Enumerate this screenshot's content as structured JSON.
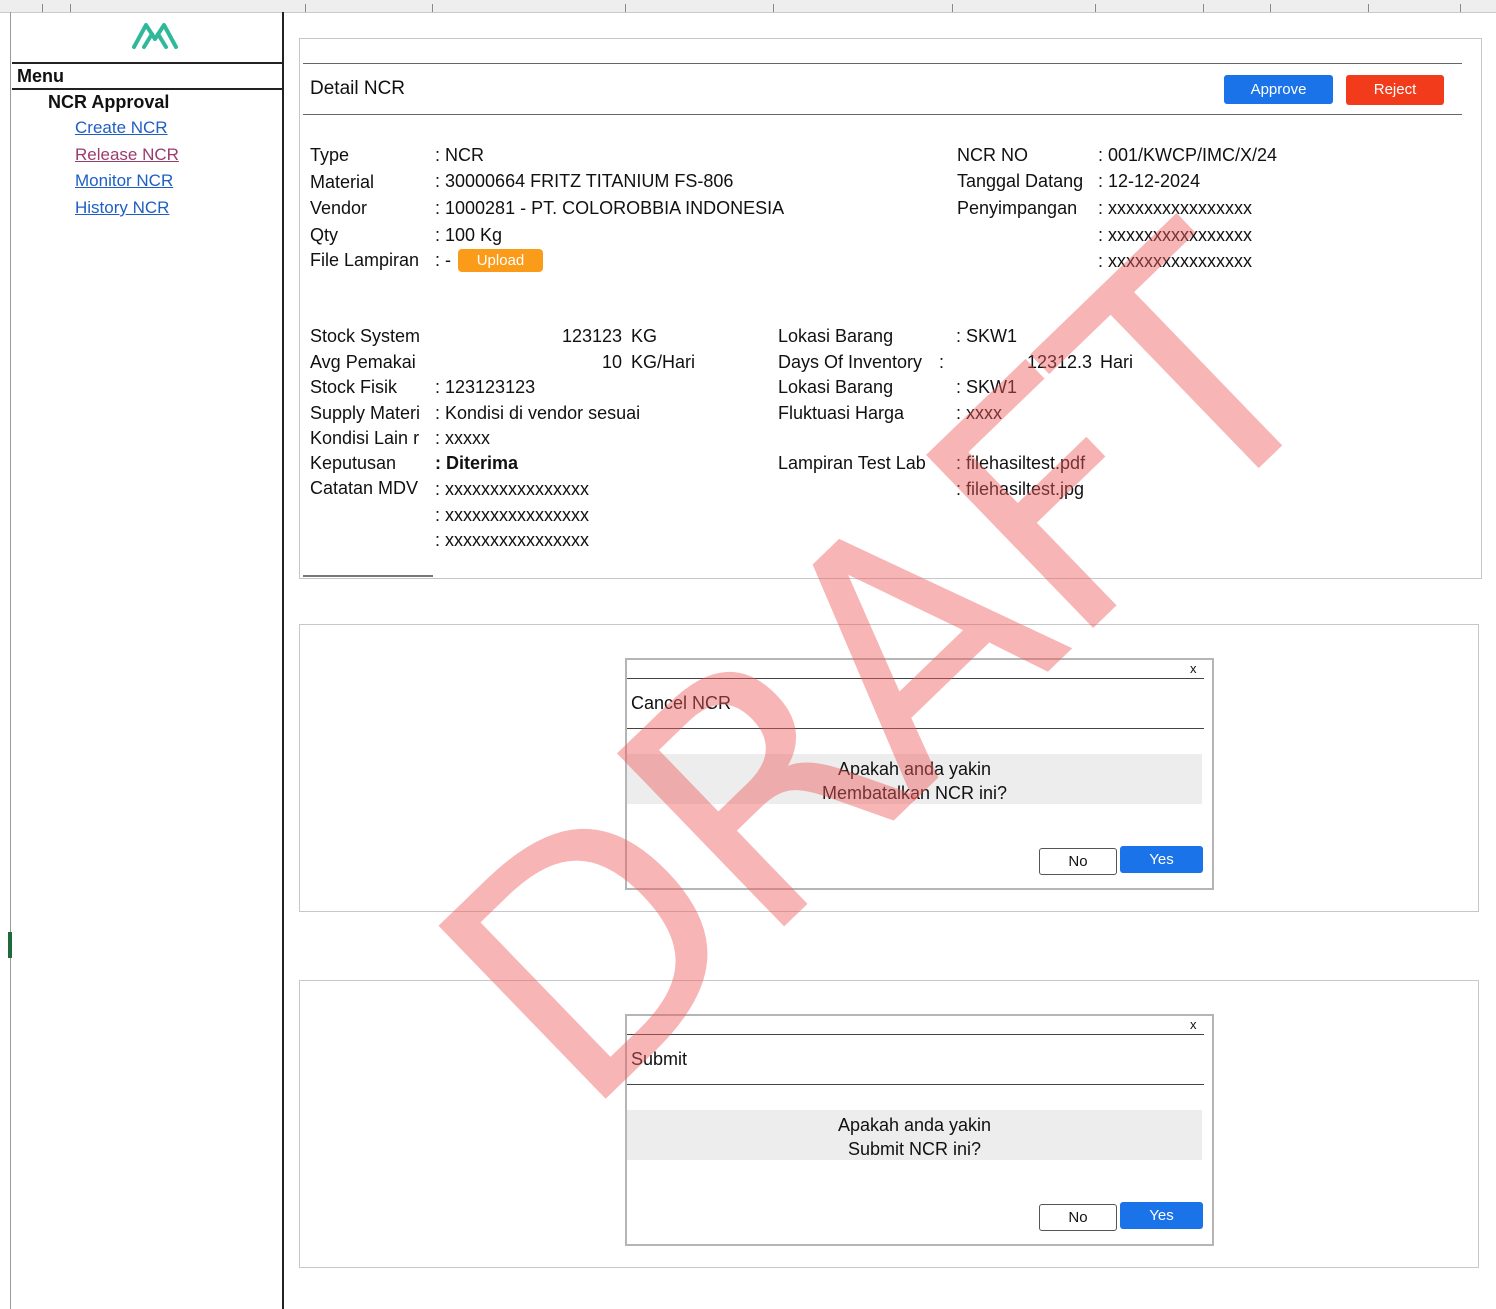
{
  "sidebar": {
    "menu_label": "Menu",
    "section_title": "NCR Approval",
    "items": [
      {
        "label": "Create NCR",
        "color": "#1f5fc4"
      },
      {
        "label": "Release NCR",
        "color": "#9b3c6e"
      },
      {
        "label": "Monitor NCR",
        "color": "#1f5fc4"
      },
      {
        "label": "History NCR",
        "color": "#1f5fc4"
      }
    ]
  },
  "detail": {
    "title": "Detail NCR",
    "approve_label": "Approve",
    "reject_label": "Reject",
    "upload_label": "Upload",
    "left": [
      {
        "label": "Type",
        "value": ": NCR"
      },
      {
        "label": "Material",
        "value": ": 30000664 FRITZ TITANIUM FS-806"
      },
      {
        "label": "Vendor",
        "value": ": 1000281 - PT. COLOROBBIA INDONESIA"
      },
      {
        "label": "Qty",
        "value": ": 100 Kg"
      },
      {
        "label": "File Lampiran",
        "value": ": -"
      }
    ],
    "right": [
      {
        "label": "NCR NO",
        "value": ": 001/KWCP/IMC/X/24"
      },
      {
        "label": "Tanggal Datang",
        "value": ": 12-12-2024"
      },
      {
        "label": "Penyimpangan",
        "value": ": xxxxxxxxxxxxxxxx"
      },
      {
        "label": "",
        "value": ": xxxxxxxxxxxxxxxx"
      },
      {
        "label": "",
        "value": ": xxxxxxxxxxxxxxxx"
      }
    ],
    "stock_system": {
      "label": "Stock System",
      "value": "123123",
      "unit": "KG"
    },
    "avg_pemakaian": {
      "label": "Avg Pemakai",
      "value": "10",
      "unit": "KG/Hari"
    },
    "stock_fisik": {
      "label": "Stock Fisik",
      "value": ": 123123123"
    },
    "supply": {
      "label": "Supply Materi",
      "value": ": Kondisi di vendor sesuai"
    },
    "kondisi": {
      "label": "Kondisi Lain r",
      "value": ": xxxxx"
    },
    "keputusan": {
      "label": "Keputusan",
      "value": ": Diterima"
    },
    "catatan": {
      "label": "Catatan MDV",
      "values": [
        ": xxxxxxxxxxxxxxxx",
        ": xxxxxxxxxxxxxxxx",
        ": xxxxxxxxxxxxxxxx"
      ]
    },
    "lokasi1": {
      "label": "Lokasi Barang",
      "value": ": SKW1"
    },
    "days_inventory": {
      "label": "Days Of Inventory",
      "colon": ":",
      "value": "12312.3",
      "unit": "Hari"
    },
    "lokasi2": {
      "label": "Lokasi Barang",
      "value": ": SKW1"
    },
    "fluktuasi": {
      "label": "Fluktuasi Harga",
      "value": ": xxxx"
    },
    "lampiran_lab": {
      "label": "Lampiran Test Lab",
      "values": [
        ": filehasiltest.pdf",
        ": filehasiltest.jpg"
      ]
    }
  },
  "cancel_dialog": {
    "close": "x",
    "title": "Cancel NCR",
    "line1": "Apakah anda yakin",
    "line2": "Membatalkan NCR ini?",
    "no_label": "No",
    "yes_label": "Yes"
  },
  "submit_dialog": {
    "close": "x",
    "title": "Submit",
    "line1": "Apakah anda yakin",
    "line2": "Submit NCR ini?",
    "no_label": "No",
    "yes_label": "Yes"
  },
  "watermark": "DRAFT",
  "colors": {
    "accent": "#1a73e8",
    "reject": "#f23b1b",
    "upload": "#fb9b1a",
    "logo": "#2fb89a",
    "watermark": "#f05a5a"
  }
}
